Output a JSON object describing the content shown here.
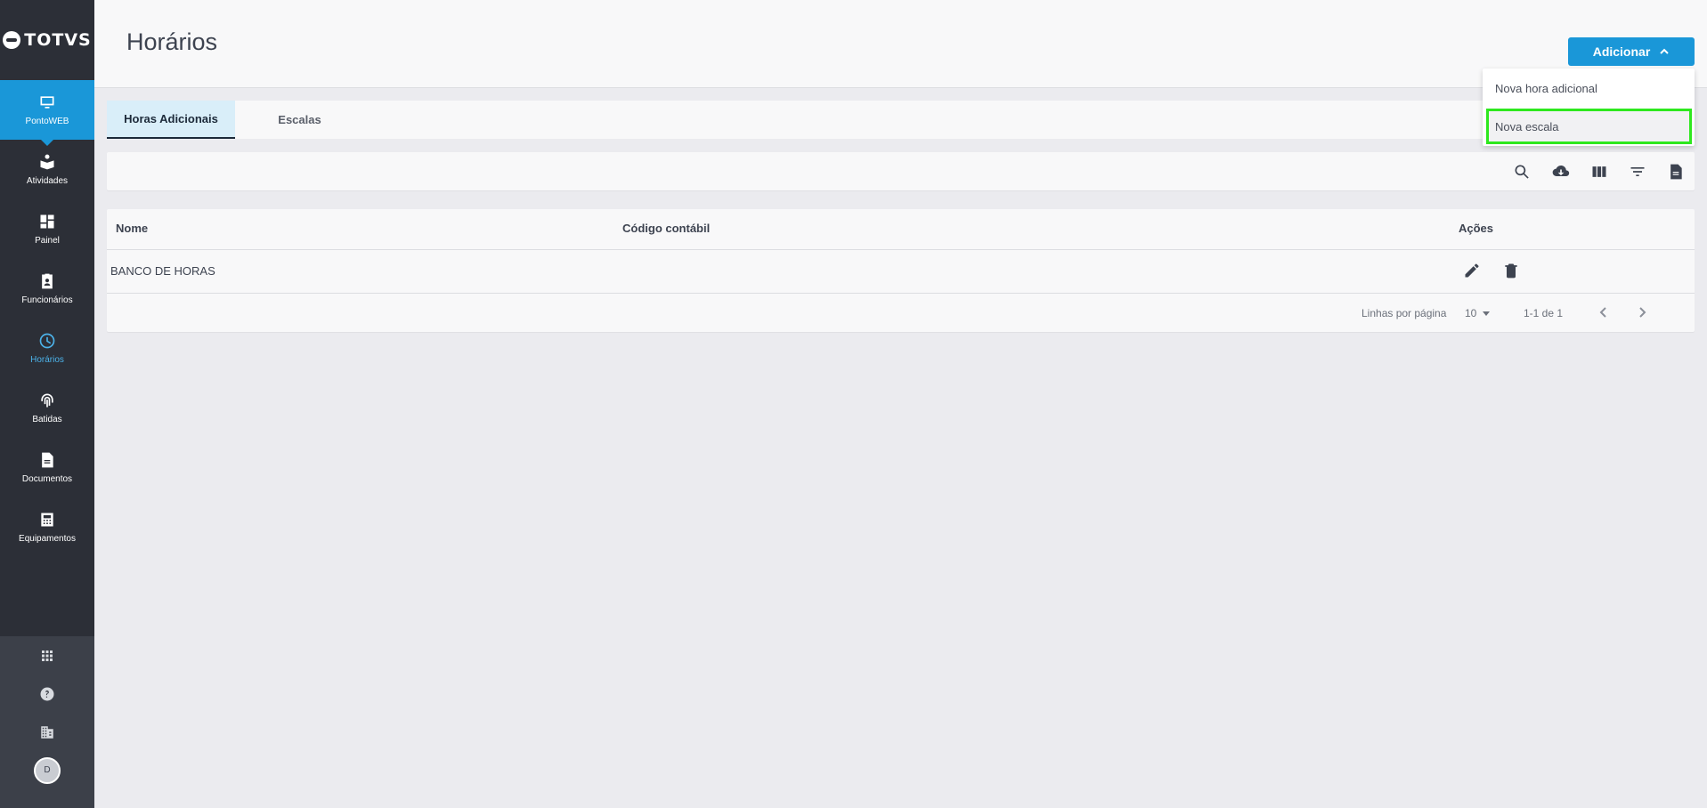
{
  "app": {
    "logo_text": "TOTVS"
  },
  "sidebar": {
    "items": [
      {
        "label": "PontoWEB",
        "icon": "monitor-icon"
      },
      {
        "label": "Atividades",
        "icon": "book-reader-icon"
      },
      {
        "label": "Painel",
        "icon": "dashboard-icon"
      },
      {
        "label": "Funcionários",
        "icon": "badge-icon"
      },
      {
        "label": "Horários",
        "icon": "clock-icon"
      },
      {
        "label": "Batidas",
        "icon": "fingerprint-icon"
      },
      {
        "label": "Documentos",
        "icon": "document-icon"
      },
      {
        "label": "Equipamentos",
        "icon": "device-icon"
      }
    ],
    "bottom": {
      "avatar_initial": "D"
    }
  },
  "header": {
    "title": "Horários",
    "add_button": "Adicionar"
  },
  "dropdown": {
    "items": [
      "Nova hora adicional",
      "Nova escala"
    ]
  },
  "tabs": [
    "Horas Adicionais",
    "Escalas"
  ],
  "table": {
    "columns": [
      "Nome",
      "Código contábil",
      "Ações"
    ],
    "rows": [
      {
        "nome": "BANCO DE HORAS",
        "codigo": ""
      }
    ],
    "footer": {
      "rows_per_page_label": "Linhas por página",
      "rows_per_page": "10",
      "range": "1-1 de 1"
    }
  },
  "colors": {
    "accent": "#1a97d8",
    "sidebar": "#2c2f37",
    "highlight": "#2ee81e"
  }
}
